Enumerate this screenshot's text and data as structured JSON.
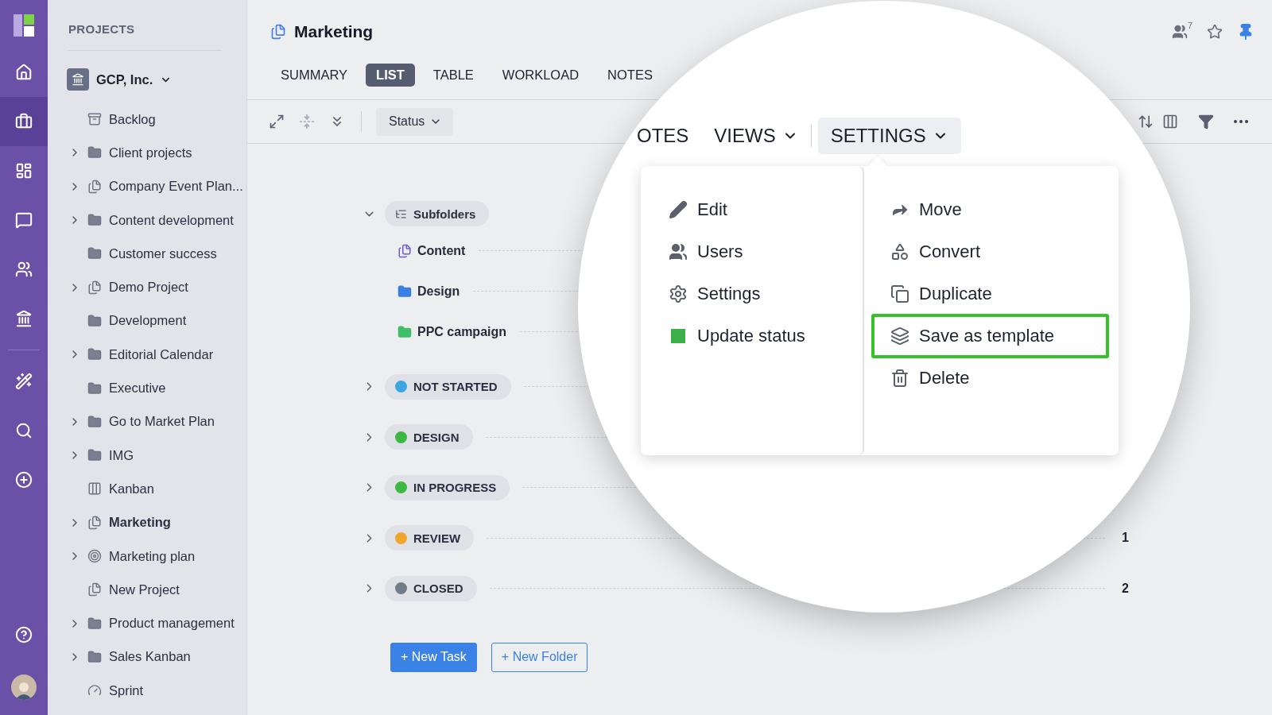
{
  "rail": {
    "top": [
      {
        "kind": "home",
        "selected": false
      },
      {
        "kind": "briefcase",
        "selected": true
      },
      {
        "kind": "dashboard",
        "selected": false
      },
      {
        "kind": "chat",
        "selected": false
      },
      {
        "kind": "users",
        "selected": false
      },
      {
        "kind": "bank",
        "selected": false
      }
    ],
    "tools": [
      {
        "kind": "wand",
        "selected": false
      },
      {
        "kind": "search",
        "selected": false
      },
      {
        "kind": "add",
        "selected": false
      }
    ],
    "bottom": [
      {
        "kind": "help",
        "selected": false
      },
      {
        "kind": "avatar",
        "selected": false
      }
    ]
  },
  "sidebar": {
    "title": "PROJECTS",
    "workspace": "GCP, Inc.",
    "items": [
      {
        "label": "Backlog",
        "kind": "archive",
        "expandable": false,
        "selected": false
      },
      {
        "label": "Client projects",
        "kind": "folder",
        "expandable": true,
        "selected": false
      },
      {
        "label": "Company Event Plan...",
        "kind": "project",
        "expandable": true,
        "selected": false
      },
      {
        "label": "Content development",
        "kind": "folder",
        "expandable": true,
        "selected": false
      },
      {
        "label": "Customer success",
        "kind": "folder",
        "expandable": false,
        "selected": false
      },
      {
        "label": "Demo Project",
        "kind": "project",
        "expandable": true,
        "selected": false
      },
      {
        "label": "Development",
        "kind": "folder",
        "expandable": false,
        "selected": false
      },
      {
        "label": "Editorial Calendar",
        "kind": "folder",
        "expandable": true,
        "selected": false
      },
      {
        "label": "Executive",
        "kind": "folder",
        "expandable": false,
        "selected": false
      },
      {
        "label": "Go to Market Plan",
        "kind": "folder",
        "expandable": true,
        "selected": false
      },
      {
        "label": "IMG",
        "kind": "folder",
        "expandable": true,
        "selected": false
      },
      {
        "label": "Kanban",
        "kind": "board",
        "expandable": false,
        "selected": false
      },
      {
        "label": "Marketing",
        "kind": "project",
        "expandable": true,
        "selected": true
      },
      {
        "label": "Marketing plan",
        "kind": "target",
        "expandable": true,
        "selected": false
      },
      {
        "label": "New Project",
        "kind": "project",
        "expandable": false,
        "selected": false
      },
      {
        "label": "Product management",
        "kind": "folder",
        "expandable": true,
        "selected": false
      },
      {
        "label": "Sales Kanban",
        "kind": "folder",
        "expandable": true,
        "selected": false
      },
      {
        "label": "Sprint",
        "kind": "sprint",
        "expandable": false,
        "selected": false
      }
    ]
  },
  "header": {
    "title": "Marketing",
    "members": "7",
    "starred": false,
    "pinned": true,
    "tabs": [
      {
        "label": "SUMMARY",
        "selected": false
      },
      {
        "label": "LIST",
        "selected": true
      },
      {
        "label": "TABLE",
        "selected": false
      },
      {
        "label": "WORKLOAD",
        "selected": false
      },
      {
        "label": "NOTES",
        "selected": false
      }
    ]
  },
  "toolbar": {
    "filter": "Status"
  },
  "list": {
    "subfolders": {
      "label": "Subfolders",
      "expanded": true,
      "children": [
        {
          "label": "Content",
          "kind": "project",
          "color": "#6a5bd6"
        },
        {
          "label": "Design",
          "kind": "folder",
          "color": "#3b7fe0"
        },
        {
          "label": "PPC campaign",
          "kind": "folder",
          "color": "#3fbf6a"
        }
      ]
    },
    "groups": [
      {
        "label": "NOT STARTED",
        "color": "#3aa7e0",
        "expanded": false
      },
      {
        "label": "DESIGN",
        "color": "#3cb843",
        "expanded": false
      },
      {
        "label": "IN PROGRESS",
        "color": "#3cb843",
        "expanded": false
      },
      {
        "label": "REVIEW",
        "color": "#f0a52b",
        "expanded": false,
        "count": "1"
      },
      {
        "label": "CLOSED",
        "color": "#707c88",
        "expanded": false,
        "count": "2"
      }
    ],
    "buttons": [
      "+ New Task",
      "+ New Folder"
    ]
  },
  "magnifier": {
    "tabs": [
      {
        "label": "OTES",
        "dropdown": false,
        "selected": false
      },
      {
        "label": "VIEWS",
        "dropdown": true,
        "selected": false
      },
      {
        "label": "SETTINGS",
        "dropdown": true,
        "selected": true
      }
    ],
    "menu": [
      [
        {
          "label": "Edit",
          "kind": "edit",
          "highlighted": false
        },
        {
          "label": "Users",
          "kind": "users",
          "highlighted": false
        },
        {
          "label": "Settings",
          "kind": "settings",
          "highlighted": false
        },
        {
          "label": "Update status",
          "kind": "status",
          "color": "#3cae4a",
          "highlighted": false
        }
      ],
      [
        {
          "label": "Move",
          "kind": "move",
          "highlighted": false
        },
        {
          "label": "Convert",
          "kind": "convert",
          "highlighted": false
        },
        {
          "label": "Duplicate",
          "kind": "duplicate",
          "highlighted": false
        },
        {
          "label": "Save as template",
          "kind": "template",
          "highlighted": true
        },
        {
          "label": "Delete",
          "kind": "delete",
          "highlighted": false
        }
      ]
    ]
  }
}
